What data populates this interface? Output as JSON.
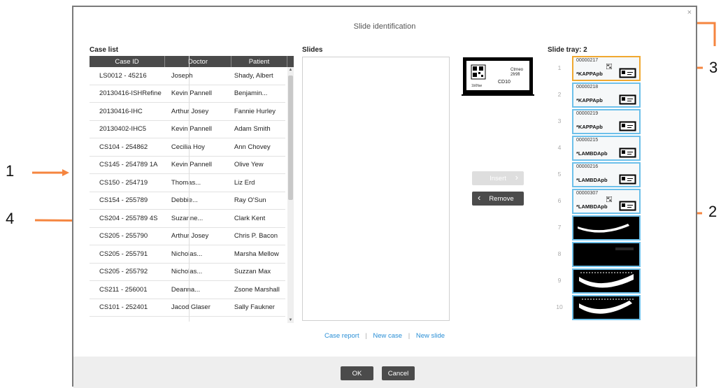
{
  "dialog": {
    "title": "Slide identification",
    "close_glyph": "×"
  },
  "case_list": {
    "label": "Case list",
    "columns": [
      "Case ID",
      "Doctor",
      "Patient"
    ],
    "rows": [
      [
        "LS0012 - 45216",
        "Joseph",
        "Shady, Albert"
      ],
      [
        "20130416-ISHRefine",
        "Kevin Pannell",
        "Benjamin..."
      ],
      [
        "20130416-IHC",
        "Arthur Josey",
        "Fannie Hurley"
      ],
      [
        "20130402-IHC5",
        "Kevin Pannell",
        "Adam Smith"
      ],
      [
        "CS104 - 254862",
        "Cecilia Hoy",
        "Ann Chovey"
      ],
      [
        "CS145 - 254789 1A",
        "Kevin Pannell",
        "Olive Yew"
      ],
      [
        "CS150 - 254719",
        "Thomas...",
        "Liz Erd"
      ],
      [
        "CS154 - 255789",
        "Debbie...",
        "Ray O'Sun"
      ],
      [
        "CS204 - 255789 4S",
        "Suzanne...",
        "Clark Kent"
      ],
      [
        "CS205 - 255790",
        "Arthur Josey",
        "Chris P. Bacon"
      ],
      [
        "CS205 - 255791",
        "Nicholas...",
        "Marsha Mellow"
      ],
      [
        "CS205 - 255792",
        "Nicholas...",
        "Suzzan Max"
      ],
      [
        "CS211 - 256001",
        "Deanna...",
        "Zsone Marshall"
      ],
      [
        "CS101 - 252401",
        "Jacod Glaser",
        "Sally Faukner"
      ]
    ]
  },
  "slides": {
    "label": "Slides"
  },
  "preview": {
    "text_top": "Ctrneo",
    "text_mid": "2fr9fl",
    "text_right": "CD10",
    "text_bottom": "1b0fae"
  },
  "actions": {
    "insert": "Insert",
    "remove": "Remove"
  },
  "tray": {
    "label": "Slide tray: 2",
    "slots": [
      {
        "num": "1",
        "id": "00000217",
        "name": "*KAPPApb",
        "kind": "label",
        "selected": true,
        "qr": true
      },
      {
        "num": "2",
        "id": "00000218",
        "name": "*KAPPApb",
        "kind": "label",
        "selected": false,
        "qr": false
      },
      {
        "num": "3",
        "id": "00000219",
        "name": "*KAPPApb",
        "kind": "label",
        "selected": false,
        "qr": false
      },
      {
        "num": "4",
        "id": "00000215",
        "name": "*LAMBDApb",
        "kind": "label",
        "selected": false,
        "qr": false
      },
      {
        "num": "5",
        "id": "00000216",
        "name": "*LAMBDApb",
        "kind": "label",
        "selected": false,
        "qr": false
      },
      {
        "num": "6",
        "id": "00000307",
        "name": "*LAMBDApb",
        "kind": "label",
        "selected": false,
        "qr": true
      },
      {
        "num": "7",
        "id": "",
        "name": "",
        "kind": "image",
        "selected": false,
        "qr": false
      },
      {
        "num": "8",
        "id": "",
        "name": "",
        "kind": "image",
        "selected": false,
        "qr": false
      },
      {
        "num": "9",
        "id": "",
        "name": "",
        "kind": "image",
        "selected": false,
        "qr": false
      },
      {
        "num": "10",
        "id": "",
        "name": "",
        "kind": "image",
        "selected": false,
        "qr": false
      }
    ]
  },
  "links": {
    "case_report": "Case report",
    "new_case": "New case",
    "new_slide": "New slide",
    "separator": "|"
  },
  "footer": {
    "ok": "OK",
    "cancel": "Cancel"
  },
  "callouts": {
    "one": "1",
    "two": "2",
    "three": "3",
    "four": "4"
  },
  "colors": {
    "accent_arrow": "#f5853f",
    "slide_border": "#6dc0ea",
    "selected_border": "#f0a830",
    "link": "#2a8fd6"
  }
}
